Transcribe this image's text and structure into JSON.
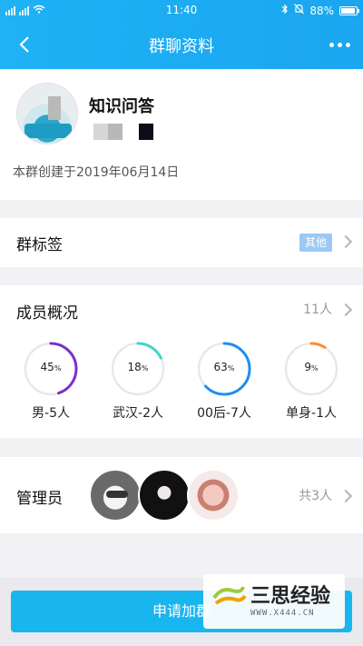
{
  "status_bar": {
    "time": "11:40",
    "battery": "88%"
  },
  "nav": {
    "title": "群聊资料",
    "back_icon": "chevron-left-icon",
    "more_icon": "more-horizontal-icon"
  },
  "profile": {
    "name": "知识问答",
    "created_text": "本群创建于2019年06月14日"
  },
  "group_tag": {
    "label": "群标签",
    "value": "其他"
  },
  "members": {
    "label": "成员概况",
    "count": "11人",
    "stats": [
      {
        "percent": 45,
        "pct_label": "45",
        "unit": "%",
        "caption": "男-5人",
        "color": "#7a2fd0"
      },
      {
        "percent": 18,
        "pct_label": "18",
        "unit": "%",
        "caption": "武汉-2人",
        "color": "#3dd6c4"
      },
      {
        "percent": 63,
        "pct_label": "63",
        "unit": "%",
        "caption": "00后-7人",
        "color": "#1f8ef0"
      },
      {
        "percent": 9,
        "pct_label": "9",
        "unit": "%",
        "caption": "单身-1人",
        "color": "#ff8a2a"
      }
    ]
  },
  "admins": {
    "label": "管理员",
    "count": "共3人"
  },
  "join_button": {
    "label": "申请加群"
  },
  "watermark": {
    "name": "三思经验",
    "url": "WWW.X444.CN"
  }
}
